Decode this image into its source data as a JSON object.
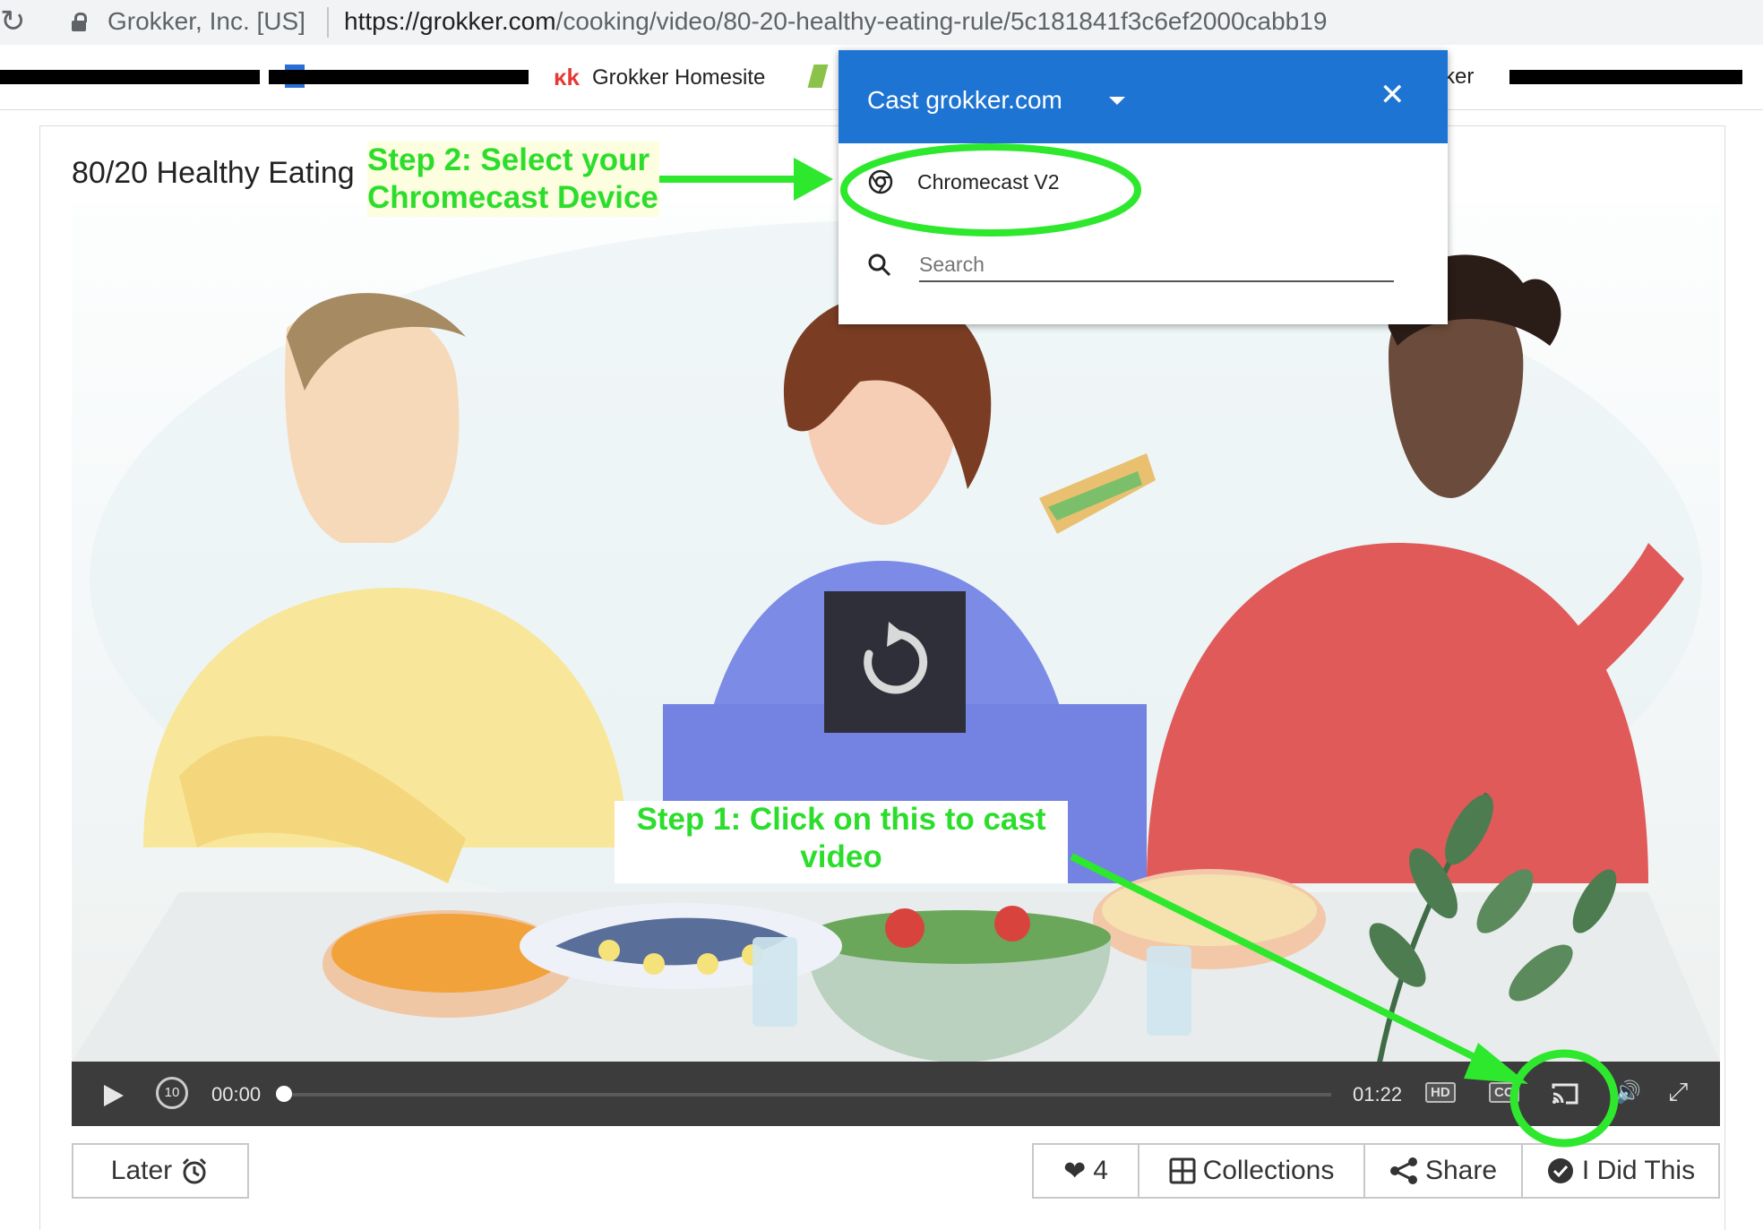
{
  "browser": {
    "site_identity": "Grokker, Inc. [US]",
    "url_domain": "https://grokker.com",
    "url_path": "/cooking/video/80-20-healthy-eating-rule/5c181841f3c6ef2000cabb19",
    "bookmarks": [
      {
        "label": "Grokker Homesite"
      },
      {
        "label": "ker"
      }
    ]
  },
  "page": {
    "title": "80/20 Healthy Eating"
  },
  "player": {
    "current_time": "00:00",
    "duration": "01:22",
    "progress": 0,
    "hd_label": "HD",
    "cc_label": "CC",
    "skip_back_label": "10"
  },
  "actions": {
    "later_label": "Later",
    "likes_count": "4",
    "collections_label": "Collections",
    "share_label": "Share",
    "did_this_label": "I Did This"
  },
  "cast_dialog": {
    "title": "Cast grokker.com",
    "device_name": "Chromecast V2",
    "search_placeholder": "Search"
  },
  "annotations": {
    "step2": "Step 2:  Select your Chromecast Device",
    "step1": "Step 1:  Click on this to cast video"
  },
  "colors": {
    "cast_header": "#1e74d2",
    "annotation_green": "#2cdd2c",
    "control_bar": "#3c3c3c"
  }
}
